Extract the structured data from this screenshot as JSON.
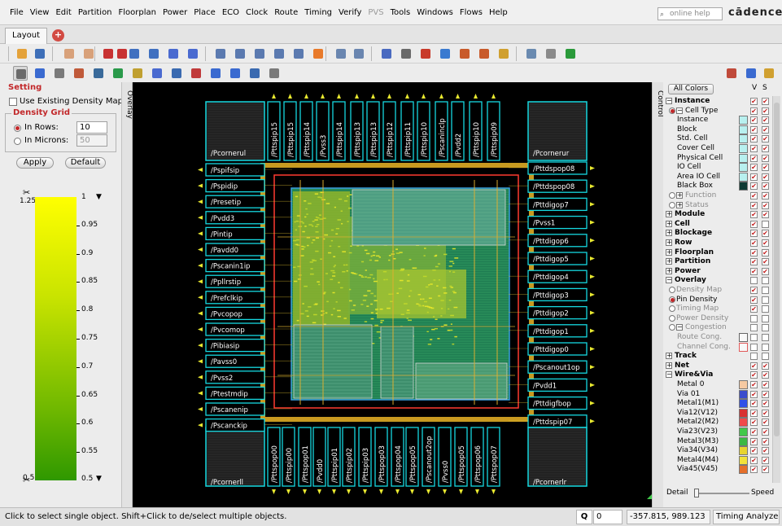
{
  "menu": {
    "items": [
      "File",
      "View",
      "Edit",
      "Partition",
      "Floorplan",
      "Power",
      "Place",
      "ECO",
      "Clock",
      "Route",
      "Timing",
      "Verify",
      "PVS",
      "Tools",
      "Windows",
      "Flows",
      "Help"
    ],
    "disabled": [
      "PVS"
    ],
    "search_placeholder": "online help",
    "logo": "cādence"
  },
  "tabs": {
    "layout": "Layout"
  },
  "left": {
    "setting_title": "Setting",
    "use_existing": "Use Existing Density Map",
    "density_grid": "Density Grid",
    "in_rows_label": "In Rows:",
    "in_rows_value": "10",
    "in_microns_label": "In Microns:",
    "in_microns_value": "50",
    "apply": "Apply",
    "default": "Default",
    "legend_top": "1.25",
    "legend_bottom": "0.5",
    "scale_top": "1",
    "scale_bottom": "0.5",
    "ticks": [
      "0.95",
      "0.9",
      "0.85",
      "0.8",
      "0.75",
      "0.7",
      "0.65",
      "0.6",
      "0.55"
    ]
  },
  "side_tabs": {
    "overlay": "Overlay",
    "control": "Control"
  },
  "canvas": {
    "top_pads": [
      "/Pttspip15",
      "/Pttspip15",
      "/Pttspip14",
      "/Pvss3",
      "/Pttspip14",
      "/Pttspip13",
      "/Pttspip13",
      "/Pttspip12",
      "/Pttspip11",
      "/Pttspip10",
      "/Pscaninclp",
      "/Pvdd2",
      "/Pttspip10",
      "/Pttspip09"
    ],
    "bottom_pads": [
      "/Pttspop00",
      "/Pttspip00",
      "/Pttspop01",
      "/Pvdd0",
      "/Pttspip01",
      "/Pttspip02",
      "/Pttspip03",
      "/Pttspop03",
      "/Pttspop04",
      "/Pttspop05",
      "/Pscanout2op",
      "/Pvss0",
      "/Pttspop05",
      "/Pttspop06",
      "/Pttspop07"
    ],
    "left_pads": [
      "/Pspifsip",
      "/Pspidip",
      "/Presetip",
      "/Pvdd3",
      "/Pintip",
      "/Pavdd0",
      "/Pscanin1ip",
      "/Ppllrstip",
      "/Prefclkip",
      "/Pvcopop",
      "/Pvcomop",
      "/Pibiasip",
      "/Pavss0",
      "/Pvss2",
      "/Ptestmdip",
      "/Pscanenip",
      "/Pscanckip"
    ],
    "right_pads": [
      "/Pttdspop08",
      "/Pttdspop08",
      "/Pttdigop7",
      "/Pvss1",
      "/Pttdigop6",
      "/Pttdigop5",
      "/Pttdigop4",
      "/Pttdigop3",
      "/Pttdigop2",
      "/Pttdigop1",
      "/Pttdigop0",
      "/Pscanout1op",
      "/Pvdd1",
      "/Pttdigfbop",
      "/Pttdspip07"
    ],
    "corner_ul": "/Pcornerul",
    "corner_ur": "/Pcornerur",
    "corner_ll": "/Pcornerll",
    "corner_lr": "/Pcornerlr"
  },
  "right": {
    "all_colors": "All Colors",
    "v": "V",
    "s": "S",
    "rows": [
      {
        "t": "Instance",
        "lvl": 0,
        "exp": "minus",
        "bold": true,
        "v": 1,
        "s": 1
      },
      {
        "t": "Cell Type",
        "lvl": 1,
        "exp": "minus",
        "radio": "on",
        "v": 1,
        "s": 1
      },
      {
        "t": "Instance",
        "lvl": 2,
        "sw": "#b8f0ef",
        "v": 1,
        "s": 1
      },
      {
        "t": "Block",
        "lvl": 2,
        "sw": "#b8f0ef",
        "v": 1,
        "s": 1
      },
      {
        "t": "Std. Cell",
        "lvl": 2,
        "sw": "#b8f0ef",
        "v": 1,
        "s": 1
      },
      {
        "t": "Cover Cell",
        "lvl": 2,
        "sw": "#b8f0ef",
        "v": 1,
        "s": 1
      },
      {
        "t": "Physical Cell",
        "lvl": 2,
        "sw": "#b8f0ef",
        "v": 1,
        "s": 1
      },
      {
        "t": "IO Cell",
        "lvl": 2,
        "sw": "#b8f0ef",
        "v": 1,
        "s": 1
      },
      {
        "t": "Area IO Cell",
        "lvl": 2,
        "sw": "#b8f0ef",
        "v": 1,
        "s": 1
      },
      {
        "t": "Black Box",
        "lvl": 2,
        "sw": "#0d3a33",
        "v": 1,
        "s": 1
      },
      {
        "t": "Function",
        "lvl": 1,
        "exp": "plus",
        "radio": "off",
        "gray": true,
        "v": 1,
        "s": 1
      },
      {
        "t": "Status",
        "lvl": 1,
        "exp": "plus",
        "radio": "off",
        "gray": true,
        "v": 1,
        "s": 1
      },
      {
        "t": "Module",
        "lvl": 0,
        "exp": "plus",
        "bold": true,
        "v": 1,
        "s": 1
      },
      {
        "t": "Cell",
        "lvl": 0,
        "exp": "plus",
        "bold": true,
        "v": 1,
        "s": 0
      },
      {
        "t": "Blockage",
        "lvl": 0,
        "exp": "plus",
        "bold": true,
        "v": 1,
        "s": 1
      },
      {
        "t": "Row",
        "lvl": 0,
        "exp": "plus",
        "bold": true,
        "v": 1,
        "s": 1
      },
      {
        "t": "Floorplan",
        "lvl": 0,
        "exp": "plus",
        "bold": true,
        "v": 1,
        "s": 1
      },
      {
        "t": "Partition",
        "lvl": 0,
        "exp": "plus",
        "bold": true,
        "v": 1,
        "s": 1
      },
      {
        "t": "Power",
        "lvl": 0,
        "exp": "plus",
        "bold": true,
        "v": 1,
        "s": 1
      },
      {
        "t": "Overlay",
        "lvl": 0,
        "exp": "minus",
        "bold": true,
        "v": 0,
        "s": 0
      },
      {
        "t": "Density Map",
        "lvl": 1,
        "radio": "off",
        "gray": true,
        "v": 1,
        "s": 0
      },
      {
        "t": "Pin Density",
        "lvl": 1,
        "radio": "on",
        "v": 1,
        "s": 0
      },
      {
        "t": "Timing Map",
        "lvl": 1,
        "radio": "off",
        "gray": true,
        "v": 1,
        "s": 0
      },
      {
        "t": "Power Density",
        "lvl": 1,
        "radio": "off",
        "gray": true,
        "v": 0,
        "s": 0
      },
      {
        "t": "Congestion",
        "lvl": 1,
        "exp": "minus",
        "radio": "off",
        "gray": true,
        "v": 0,
        "s": 0
      },
      {
        "t": "Route Cong.",
        "lvl": 2,
        "sw": "#f8f8f8",
        "swb": "#666",
        "gray": true,
        "v": 0,
        "s": 0
      },
      {
        "t": "Channel Cong.",
        "lvl": 2,
        "sw": "#f8f8f8",
        "swb": "#e05a5a",
        "gray": true,
        "v": 0,
        "s": 0
      },
      {
        "t": "Track",
        "lvl": 0,
        "exp": "plus",
        "bold": true,
        "v": 0,
        "s": 0
      },
      {
        "t": "Net",
        "lvl": 0,
        "exp": "plus",
        "bold": true,
        "v": 1,
        "s": 1
      },
      {
        "t": "Wire&Via",
        "lvl": 0,
        "exp": "minus",
        "bold": true,
        "v": 1,
        "s": 1
      },
      {
        "t": "Metal 0",
        "lvl": 2,
        "sw": "#f6c9a2",
        "v": 1,
        "s": 1
      },
      {
        "t": "Via 01",
        "lvl": 2,
        "sw": "#3a4ccd",
        "v": 1,
        "s": 1
      },
      {
        "t": "Metal1(M1)",
        "lvl": 2,
        "sw": "#3050e8",
        "v": 1,
        "s": 1
      },
      {
        "t": "Via12(V12)",
        "lvl": 2,
        "sw": "#d83030",
        "v": 1,
        "s": 1
      },
      {
        "t": "Metal2(M2)",
        "lvl": 2,
        "sw": "#f04a4a",
        "v": 1,
        "s": 1
      },
      {
        "t": "Via23(V23)",
        "lvl": 2,
        "sw": "#41c84a",
        "v": 1,
        "s": 1
      },
      {
        "t": "Metal3(M3)",
        "lvl": 2,
        "sw": "#3cb845",
        "v": 1,
        "s": 1
      },
      {
        "t": "Via34(V34)",
        "lvl": 2,
        "sw": "#e8d430",
        "v": 1,
        "s": 1
      },
      {
        "t": "Metal4(M4)",
        "lvl": 2,
        "sw": "#f2e23a",
        "v": 1,
        "s": 1
      },
      {
        "t": "Via45(V45)",
        "lvl": 2,
        "sw": "#e56f2a",
        "v": 1,
        "s": 1
      }
    ],
    "detail": "Detail",
    "speed": "Speed"
  },
  "status": {
    "message": "Click to select single object. Shift+Click to de/select multiple objects.",
    "q": "Q",
    "q_value": "0",
    "coords": "-357.815, 989.123",
    "timing": "Timing Analyzed"
  },
  "colors": {
    "pad": "#16d8e0",
    "accent": "#c2282a"
  }
}
